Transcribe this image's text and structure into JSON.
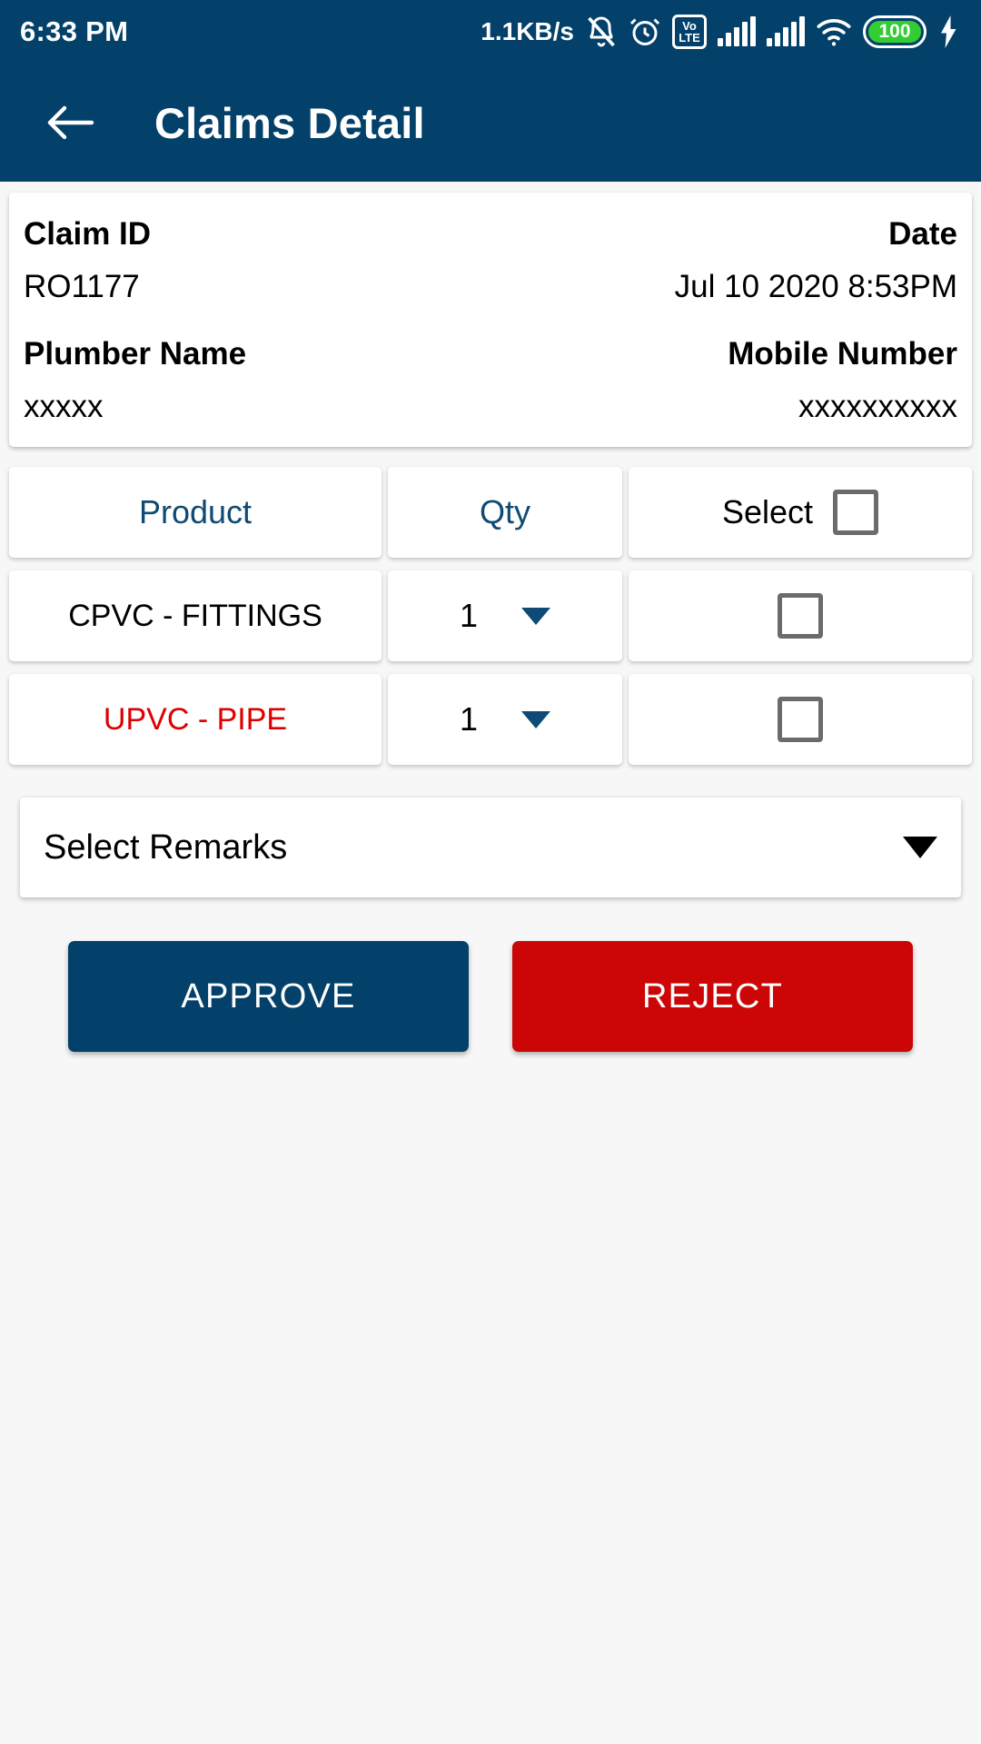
{
  "status_bar": {
    "time": "6:33 PM",
    "network_speed": "1.1KB/s",
    "volte_top": "Vo",
    "volte_bottom": "LTE",
    "battery_level": "100"
  },
  "app_bar": {
    "title": "Claims Detail",
    "back_icon": "arrow-left-icon"
  },
  "claim_info": {
    "claim_id_label": "Claim ID",
    "claim_id_value": "RO1177",
    "date_label": "Date",
    "date_value": "Jul 10 2020  8:53PM",
    "plumber_name_label": "Plumber Name",
    "plumber_name_value": "xxxxx",
    "mobile_number_label": "Mobile Number",
    "mobile_number_value": "xxxxxxxxxx"
  },
  "product_table": {
    "headers": {
      "product": "Product",
      "qty": "Qty",
      "select": "Select"
    },
    "rows": [
      {
        "product": "CPVC - FITTINGS",
        "qty": "1",
        "selected": false,
        "highlight": false
      },
      {
        "product": "UPVC - PIPE",
        "qty": "1",
        "selected": false,
        "highlight": true
      }
    ]
  },
  "remarks": {
    "selected_value": "Select Remarks"
  },
  "actions": {
    "approve_label": "APPROVE",
    "reject_label": "REJECT"
  },
  "colors": {
    "primary_blue": "#03406A",
    "reject_red": "#CC0606",
    "header_link_blue": "#104a73",
    "alert_red": "#dd0000",
    "battery_green": "#33cc33"
  }
}
